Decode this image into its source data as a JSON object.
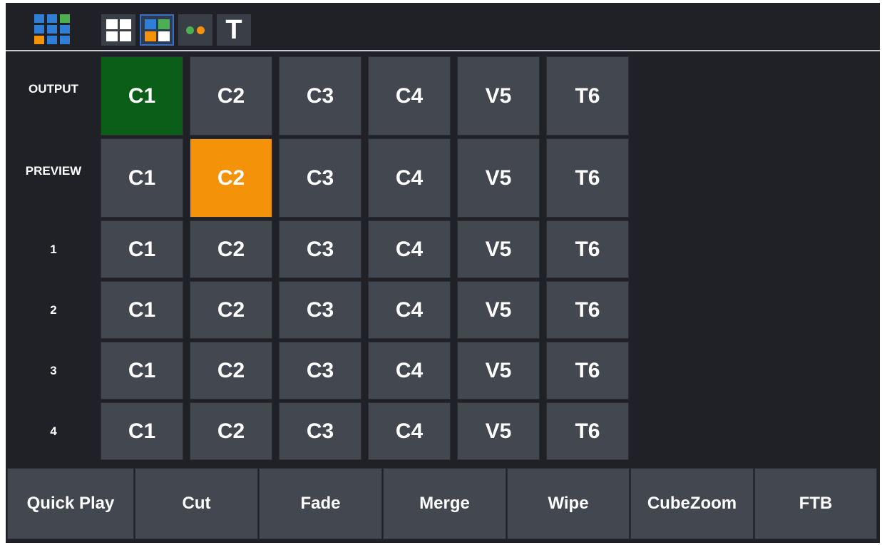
{
  "toolbar": {
    "logo_icon": "multiview-grid-logo-icon",
    "buttons": [
      {
        "name": "layout-grid-icon",
        "active": false
      },
      {
        "name": "layout-grid-color-icon",
        "active": true
      },
      {
        "name": "record-dots-icon",
        "active": false
      },
      {
        "name": "text-overlay-icon",
        "label": "T",
        "active": false
      }
    ]
  },
  "colors": {
    "background": "#1f2126",
    "button": "#434850",
    "program": "#0b5e18",
    "preview": "#f4930a",
    "accent_blue": "#3b6fbf",
    "logo_green": "#4caf50",
    "logo_orange": "#f4930a",
    "logo_blue": "#2f7fd6"
  },
  "rows": [
    {
      "label": "OUTPUT",
      "cells": [
        "C1",
        "C2",
        "C3",
        "C4",
        "V5",
        "T6"
      ],
      "selected": 0,
      "selected_state": "program"
    },
    {
      "label": "PREVIEW",
      "cells": [
        "C1",
        "C2",
        "C3",
        "C4",
        "V5",
        "T6"
      ],
      "selected": 1,
      "selected_state": "preview"
    },
    {
      "label": "1",
      "cells": [
        "C1",
        "C2",
        "C3",
        "C4",
        "V5",
        "T6"
      ]
    },
    {
      "label": "2",
      "cells": [
        "C1",
        "C2",
        "C3",
        "C4",
        "V5",
        "T6"
      ]
    },
    {
      "label": "3",
      "cells": [
        "C1",
        "C2",
        "C3",
        "C4",
        "V5",
        "T6"
      ]
    },
    {
      "label": "4",
      "cells": [
        "C1",
        "C2",
        "C3",
        "C4",
        "V5",
        "T6"
      ]
    }
  ],
  "transitions": [
    "Quick Play",
    "Cut",
    "Fade",
    "Merge",
    "Wipe",
    "CubeZoom",
    "FTB"
  ]
}
